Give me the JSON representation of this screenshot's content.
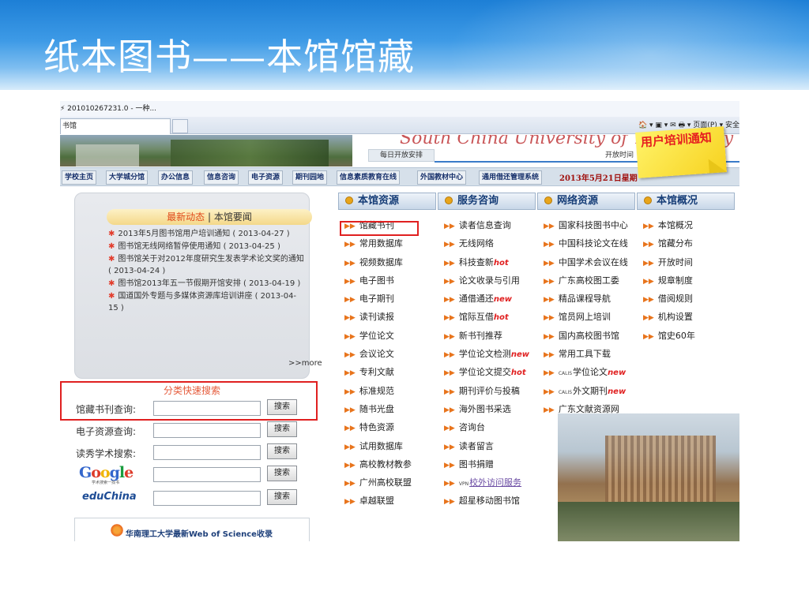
{
  "slide": {
    "title": "纸本图书——本馆馆藏"
  },
  "browser": {
    "url_text": "⚡ 201010267231.0 - 一种...",
    "tab_label": "书馆",
    "tools_text": "🏠 ▾  ▣ ▾  ✉  🖶 ▾  页面(P) ▾  安全"
  },
  "banner": {
    "university_name": "South China University of Technology",
    "opening_tab": "每日开放安排",
    "open_time": "开放时间",
    "notice": "用户培训通知"
  },
  "nav": {
    "items": [
      "学校主页",
      "大学城分馆",
      "办公信息",
      "信息咨询",
      "电子资源",
      "期刊园地",
      "信息素质教育在线",
      "外国教材中心",
      "通用借还管理系统"
    ],
    "date": "2013年5月21日星期"
  },
  "news": {
    "header_primary": "最新动态",
    "header_sep": "|",
    "header_secondary": "本馆要闻",
    "items": [
      "2013年5月图书馆用户培训通知 ( 2013-04-27 )",
      "图书馆无线网络暂停使用通知 ( 2013-04-25 )",
      "图书馆关于对2012年度研究生发表学术论文奖的通知 ( 2013-04-24 )",
      "图书馆2013年五一节假期开馆安排 ( 2013-04-19 )",
      "国道国外专题与多媒体资源库培训讲座 ( 2013-04-15 )"
    ],
    "more": ">>more"
  },
  "search": {
    "title": "分类快速搜索",
    "rows": [
      {
        "label": "馆藏书刊查询:",
        "button": "搜索"
      },
      {
        "label": "电子资源查询:",
        "button": "搜索"
      },
      {
        "label": "读秀学术搜索:",
        "button": "搜索"
      },
      {
        "label": "Google",
        "button": "搜索"
      },
      {
        "label": "eduChina",
        "button": "搜索"
      }
    ],
    "google_sub": "学术搜索一找书"
  },
  "wos": {
    "text": "华南理工大学最新Web of Science收录"
  },
  "columns": [
    {
      "title": "本馆资源",
      "items": [
        "馆藏书刊",
        "常用数据库",
        "视频数据库",
        "电子图书",
        "电子期刊",
        "读刊读报",
        "学位论文",
        "会议论文",
        "专利文献",
        "标准规范",
        "随书光盘",
        "特色资源",
        "试用数据库",
        "高校教材教参",
        "广州高校联盟",
        "卓越联盟"
      ]
    },
    {
      "title": "服务咨询",
      "items": [
        "读者信息查询",
        "无线网络",
        "科技查新",
        "论文收录与引用",
        "通借通还",
        "馆际互借",
        "新书刊推荐",
        "学位论文检测",
        "学位论文提交",
        "期刊评价与投稿",
        "海外图书采选",
        "咨询台",
        "读者留言",
        "图书捐赠",
        "校外访问服务",
        "超星移动图书馆"
      ]
    },
    {
      "title": "网络资源",
      "items": [
        "国家科技图书中心",
        "中国科技论文在线",
        "中国学术会议在线",
        "广东高校图工委",
        "精品课程导航",
        "馆员网上培训",
        "国内高校图书馆",
        "常用工具下载",
        "学位论文",
        "外文期刊",
        "广东文献资源网"
      ]
    },
    {
      "title": "本馆概况",
      "items": [
        "本馆概况",
        "馆藏分布",
        "开放时间",
        "规章制度",
        "借阅规则",
        "机构设置",
        "馆史60年"
      ]
    }
  ],
  "tags": {
    "hot": "hot",
    "new": "new",
    "calis": "CALIS",
    "vpn": "VPN"
  },
  "colors": {
    "highlight_frame": "#e02020",
    "nav_text": "#17306b",
    "tag": "#e02020"
  }
}
